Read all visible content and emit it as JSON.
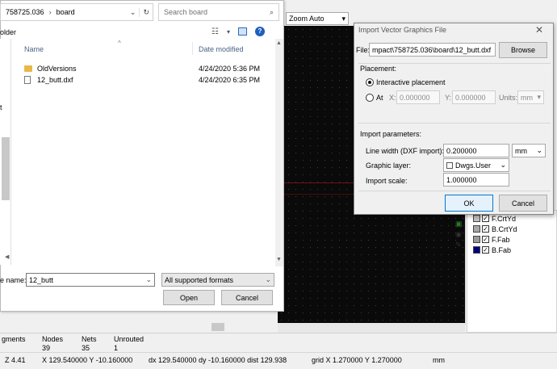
{
  "kicad": {
    "zoom_label": "Zoom Auto",
    "layers": [
      {
        "name": "F.CrtYd",
        "color": "#c2c2c2"
      },
      {
        "name": "B.CrtYd",
        "color": "#a8a8a8"
      },
      {
        "name": "F.Fab",
        "color": "#9a9a9a"
      },
      {
        "name": "B.Fab",
        "color": "#000084"
      }
    ],
    "stats": {
      "segments_label": "gments",
      "segments_value": "39",
      "nodes_label": "Nodes",
      "nodes_value": "39",
      "nets_label": "Nets",
      "nets_value": "35",
      "unrouted_label": "Unrouted",
      "unrouted_value": "1"
    },
    "status_bar": {
      "zoom": "Z 4.41",
      "xy": "X 129.540000  Y -10.160000",
      "delta": "dx 129.540000  dy -10.160000  dist 129.938",
      "grid": "grid X 1.270000  Y 1.270000",
      "units": "mm"
    }
  },
  "file_dialog": {
    "breadcrumb_part1": "758725.036",
    "breadcrumb_part2": "board",
    "search_placeholder": "Search board",
    "nav_folder_label": "older",
    "columns": {
      "name": "Name",
      "date": "Date modified"
    },
    "files": [
      {
        "name": "OldVersions",
        "date": "4/24/2020 5:36 PM",
        "type": "folder"
      },
      {
        "name": "12_butt.dxf",
        "date": "4/24/2020 6:35 PM",
        "type": "file"
      }
    ],
    "filename_label": "e name:",
    "filename_value": "12_butt",
    "filetype_value": "All supported formats",
    "open_label": "Open",
    "cancel_label": "Cancel"
  },
  "import_dialog": {
    "title": "Import Vector Graphics File",
    "file_label": "File:",
    "file_value": "mpact\\758725.036\\board\\12_butt.dxf",
    "browse_label": "Browse",
    "placement_header": "Placement:",
    "interactive_label": "Interactive placement",
    "at_label": "At",
    "x_label": "X:",
    "x_value": "0.000000",
    "y_label": "Y:",
    "y_value": "0.000000",
    "units_label": "Units:",
    "units_value": "mm",
    "import_params_header": "Import parameters:",
    "line_width_label": "Line width (DXF import):",
    "line_width_value": "0.200000",
    "line_width_units": "mm",
    "graphic_layer_label": "Graphic layer:",
    "graphic_layer_value": "Dwgs.User",
    "import_scale_label": "Import scale:",
    "import_scale_value": "1.000000",
    "ok_label": "OK",
    "cancel_label": "Cancel"
  }
}
